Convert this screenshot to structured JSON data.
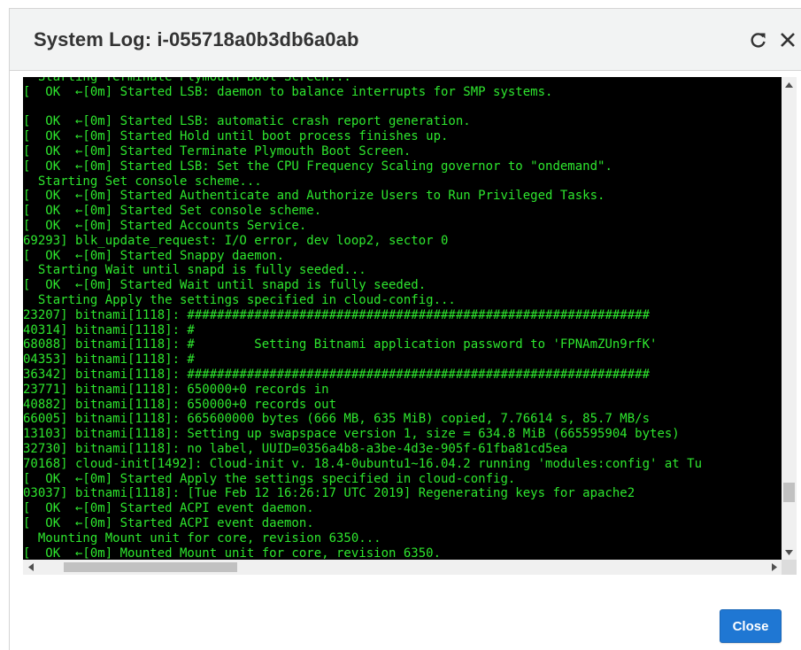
{
  "dialog": {
    "title": "System Log: i-055718a0b3db6a0ab",
    "refresh_icon": "refresh-icon",
    "close_icon": "close-icon",
    "close_button_label": "Close"
  },
  "colors": {
    "log_background": "#000000",
    "log_text": "#2ee62e",
    "primary_button": "#1f77d3",
    "header_background": "#f2f3f3"
  },
  "log": {
    "lines": [
      "  Starting Terminate Plymouth Boot Screen...",
      "[  OK  ←[0m] Started LSB: daemon to balance interrupts for SMP systems.",
      "",
      "[  OK  ←[0m] Started LSB: automatic crash report generation.",
      "[  OK  ←[0m] Started Hold until boot process finishes up.",
      "[  OK  ←[0m] Started Terminate Plymouth Boot Screen.",
      "[  OK  ←[0m] Started LSB: Set the CPU Frequency Scaling governor to \"ondemand\".",
      "  Starting Set console scheme...",
      "[  OK  ←[0m] Started Authenticate and Authorize Users to Run Privileged Tasks.",
      "[  OK  ←[0m] Started Set console scheme.",
      "[  OK  ←[0m] Started Accounts Service.",
      "69293] blk_update_request: I/O error, dev loop2, sector 0",
      "[  OK  ←[0m] Started Snappy daemon.",
      "  Starting Wait until snapd is fully seeded...",
      "[  OK  ←[0m] Started Wait until snapd is fully seeded.",
      "  Starting Apply the settings specified in cloud-config...",
      "23207] bitnami[1118]: ##############################################################",
      "40314] bitnami[1118]: #",
      "68088] bitnami[1118]: #        Setting Bitnami application password to 'FPNAmZUn9rfK'",
      "04353] bitnami[1118]: #",
      "36342] bitnami[1118]: ##############################################################",
      "23771] bitnami[1118]: 650000+0 records in",
      "40882] bitnami[1118]: 650000+0 records out",
      "66005] bitnami[1118]: 665600000 bytes (666 MB, 635 MiB) copied, 7.76614 s, 85.7 MB/s",
      "13103] bitnami[1118]: Setting up swapspace version 1, size = 634.8 MiB (665595904 bytes)",
      "32730] bitnami[1118]: no label, UUID=0356a4b8-a3be-4d3e-905f-61fba81cd5ea",
      "70168] cloud-init[1492]: Cloud-init v. 18.4-0ubuntu1~16.04.2 running 'modules:config' at Tu",
      "[  OK  ←[0m] Started Apply the settings specified in cloud-config.",
      "03037] bitnami[1118]: [Tue Feb 12 16:26:17 UTC 2019] Regenerating keys for apache2",
      "[  OK  ←[0m] Started ACPI event daemon.",
      "[  OK  ←[0m] Started ACPI event daemon.",
      "  Mounting Mount unit for core, revision 6350...",
      "[  OK  ←[0m] Mounted Mount unit for core, revision 6350."
    ]
  }
}
